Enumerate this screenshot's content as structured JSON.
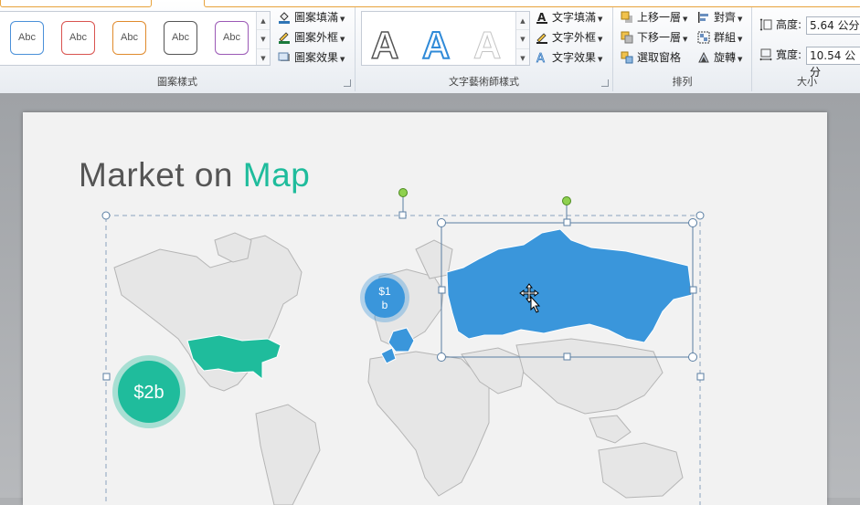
{
  "ribbon": {
    "shape_styles": {
      "label": "圖案樣式",
      "swatch_text": "Abc",
      "swatch_colors": [
        "#4a90d9",
        "#d9534f",
        "#e08a2c",
        "#555555",
        "#9b59b6"
      ],
      "fill": "圖案填滿",
      "outline": "圖案外框",
      "effects": "圖案效果"
    },
    "wordart": {
      "label": "文字藝術師樣式",
      "samples": [
        "A",
        "A",
        "A"
      ],
      "text_fill": "文字填滿",
      "text_outline": "文字外框",
      "text_effects": "文字效果"
    },
    "arrange": {
      "label": "排列",
      "bring_forward": "上移一層",
      "send_backward": "下移一層",
      "selection_pane": "選取窗格",
      "align": "對齊",
      "group": "群組",
      "rotate": "旋轉"
    },
    "size": {
      "label": "大小",
      "height_label": "高度:",
      "height_value": "5.64 公分",
      "width_label": "寬度:",
      "width_value": "10.54 公分"
    }
  },
  "slide": {
    "title_part1": "Market on",
    "title_part2": "Map",
    "bubble_us": "$2b",
    "bubble_eu_line1": "$1",
    "bubble_eu_line2": "b",
    "colors": {
      "teal": "#1fbc9c",
      "blue": "#3a96db",
      "map_gray": "#e6e6e6",
      "map_stroke": "#b5b5b5"
    }
  }
}
